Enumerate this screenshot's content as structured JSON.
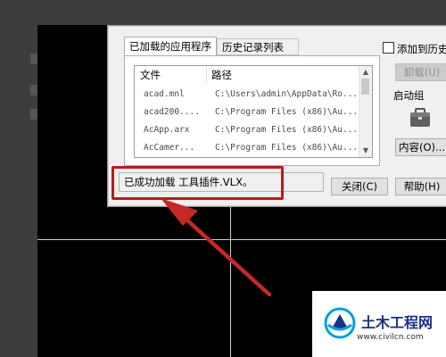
{
  "dialog": {
    "tabs": [
      {
        "label": "已加载的应用程序",
        "active": true
      },
      {
        "label": "历史记录列表",
        "active": false
      }
    ],
    "columns": {
      "file": "文件",
      "path": "路径"
    },
    "rows": [
      {
        "file": "acad.mnl",
        "path": "C:\\Users\\admin\\AppData\\Ro..."
      },
      {
        "file": "acad200....",
        "path": "C:\\Program Files (x86)\\Au..."
      },
      {
        "file": "AcApp.arx",
        "path": "C:\\Program Files (x86)\\Au..."
      },
      {
        "file": "AcCamer...",
        "path": "C:\\Program Files (x86)\\Au..."
      }
    ],
    "add_history_label": "添加到历史",
    "unload_label": "卸载(U)",
    "startup_group_label": "启动组",
    "contents_label": "内容(O)...",
    "status_text": "已成功加载 工具插件.VLX。",
    "close_label": "关闭(C)",
    "help_label": "帮助(H)"
  },
  "watermark": {
    "title": "土木工程网",
    "url": "www.civilcn.com"
  },
  "colors": {
    "highlight": "#b71c1c",
    "logo_blue": "#1a2f86",
    "logo_cyan": "#00a0e0"
  }
}
